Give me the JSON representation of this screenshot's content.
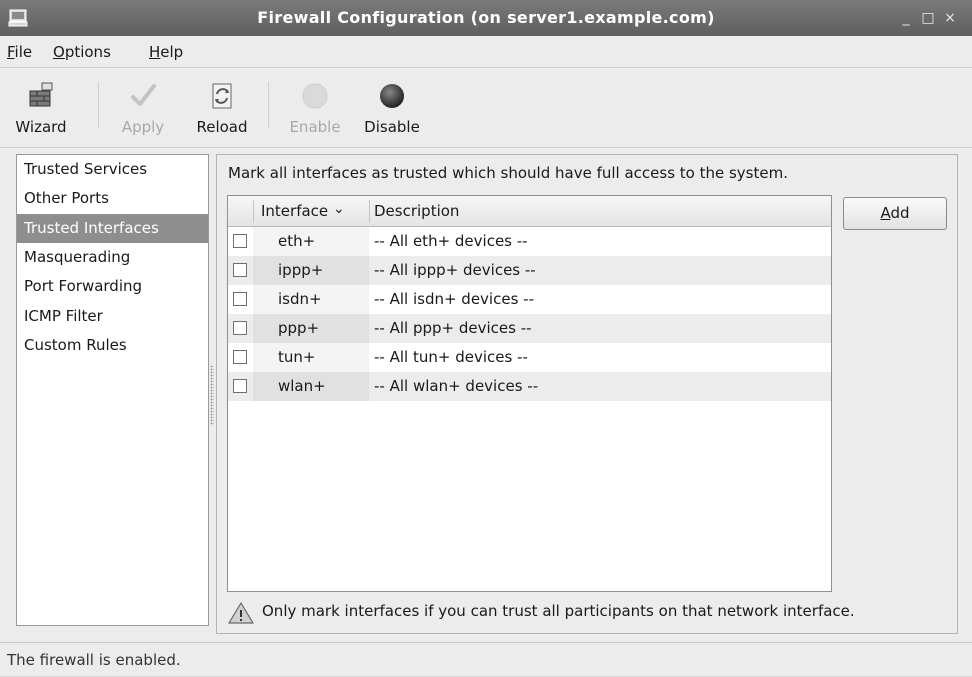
{
  "window": {
    "title": "Firewall Configuration (on server1.example.com)",
    "controls": {
      "minimize": "_",
      "maximize": "□",
      "close": "×"
    }
  },
  "menu": [
    {
      "label": "File",
      "mnemonic": "F",
      "rest": "ile"
    },
    {
      "label": "Options",
      "mnemonic": "O",
      "rest": "ptions"
    },
    {
      "label": "Help",
      "mnemonic": "H",
      "rest": "elp"
    }
  ],
  "toolbar": {
    "wizard": {
      "label": "Wizard",
      "icon": "wizard-icon",
      "enabled": true
    },
    "apply": {
      "label": "Apply",
      "icon": "checkmark-icon",
      "enabled": false
    },
    "reload": {
      "label": "Reload",
      "icon": "reload-icon",
      "enabled": true
    },
    "enable": {
      "label": "Enable",
      "icon": "enable-icon",
      "enabled": false
    },
    "disable": {
      "label": "Disable",
      "icon": "disable-icon",
      "enabled": true
    }
  },
  "sidebar": {
    "items": [
      {
        "label": "Trusted Services",
        "selected": false
      },
      {
        "label": "Other Ports",
        "selected": false
      },
      {
        "label": "Trusted Interfaces",
        "selected": true
      },
      {
        "label": "Masquerading",
        "selected": false
      },
      {
        "label": "Port Forwarding",
        "selected": false
      },
      {
        "label": "ICMP Filter",
        "selected": false
      },
      {
        "label": "Custom Rules",
        "selected": false
      }
    ]
  },
  "main": {
    "description": "Mark all interfaces as trusted which should have full access to the system.",
    "table": {
      "columns": {
        "interface": "Interface",
        "sort_indicator": "⌄",
        "description": "Description"
      },
      "rows": [
        {
          "interface": "eth+",
          "description": "-- All eth+ devices --",
          "checked": false
        },
        {
          "interface": "ippp+",
          "description": "-- All ippp+ devices --",
          "checked": false
        },
        {
          "interface": "isdn+",
          "description": "-- All isdn+ devices --",
          "checked": false
        },
        {
          "interface": "ppp+",
          "description": "-- All ppp+ devices --",
          "checked": false
        },
        {
          "interface": "tun+",
          "description": "-- All tun+ devices --",
          "checked": false
        },
        {
          "interface": "wlan+",
          "description": "-- All wlan+ devices --",
          "checked": false
        }
      ]
    },
    "add_button": {
      "label": "Add",
      "mnemonic": "A",
      "rest": "dd"
    },
    "warning": "Only mark interfaces if you can trust all participants on that network interface."
  },
  "status": "The firewall is enabled.",
  "colors": {
    "titlebar": "#6b6b6b",
    "selection": "#8e8e8e",
    "alt_row": "#ececec",
    "window_bg": "#ececec"
  }
}
